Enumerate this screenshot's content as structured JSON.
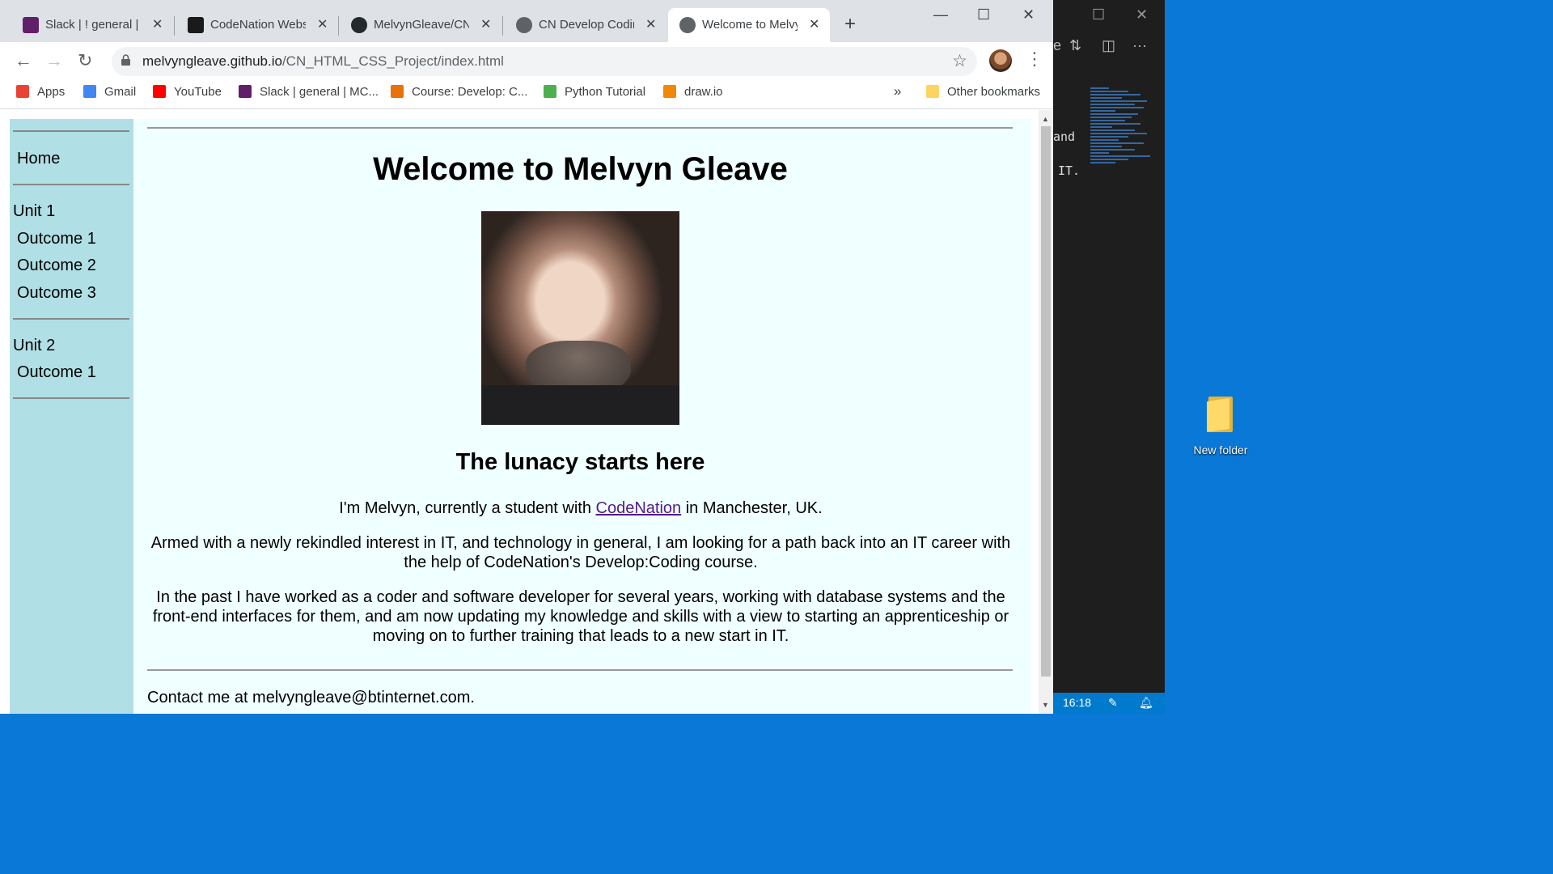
{
  "desktop": {
    "folder_label": "New folder"
  },
  "editor": {
    "code_lines": [
      "and",
      "IT."
    ],
    "clock": "16:18"
  },
  "browser": {
    "tabs": [
      {
        "title": "Slack | ! general | M",
        "color": "#611f69",
        "active": false
      },
      {
        "title": "CodeNation Websit",
        "color": "#1a1a1a",
        "active": false
      },
      {
        "title": "MelvynGleave/CN_",
        "color": "#24292e",
        "active": false
      },
      {
        "title": "CN Develop Coding",
        "color": "#5f6368",
        "active": false
      },
      {
        "title": "Welcome to Melvyn",
        "color": "#5f6368",
        "active": true
      }
    ],
    "url_host": "melvyngleave.github.io",
    "url_path": "/CN_HTML_CSS_Project/index.html",
    "bookmarks": [
      {
        "label": "Apps",
        "color": "#ea4335"
      },
      {
        "label": "Gmail",
        "color": "#4285f4"
      },
      {
        "label": "YouTube",
        "color": "#ff0000"
      },
      {
        "label": "Slack | general | MC...",
        "color": "#611f69"
      },
      {
        "label": "Course: Develop: C...",
        "color": "#e8710a"
      },
      {
        "label": "Python Tutorial",
        "color": "#4caf50"
      },
      {
        "label": "draw.io",
        "color": "#f08705"
      }
    ],
    "bookmarks_overflow": "»",
    "other_bookmarks": "Other bookmarks"
  },
  "page": {
    "nav": {
      "home": "Home",
      "unit1": "Unit 1",
      "unit1_outcomes": [
        "Outcome 1",
        "Outcome 2",
        "Outcome 3"
      ],
      "unit2": "Unit 2",
      "unit2_outcomes": [
        "Outcome 1"
      ]
    },
    "heading": "Welcome to Melvyn Gleave",
    "subheading": "The lunacy starts here",
    "intro_before": "I'm Melvyn, currently a student with ",
    "intro_link": "CodeNation",
    "intro_after": " in Manchester, UK.",
    "paragraph2": "Armed with a newly rekindled interest in IT, and technology in general, I am looking for a path back into an IT career with the help of CodeNation's Develop:Coding course.",
    "paragraph3": "In the past I have worked as a coder and software developer for several years, working with database systems and the front-end interfaces for them, and am now updating my knowledge and skills with a view to starting an apprenticeship or moving on to further training that leads to a new start in IT.",
    "contact": "Contact me at melvyngleave@btinternet.com."
  }
}
